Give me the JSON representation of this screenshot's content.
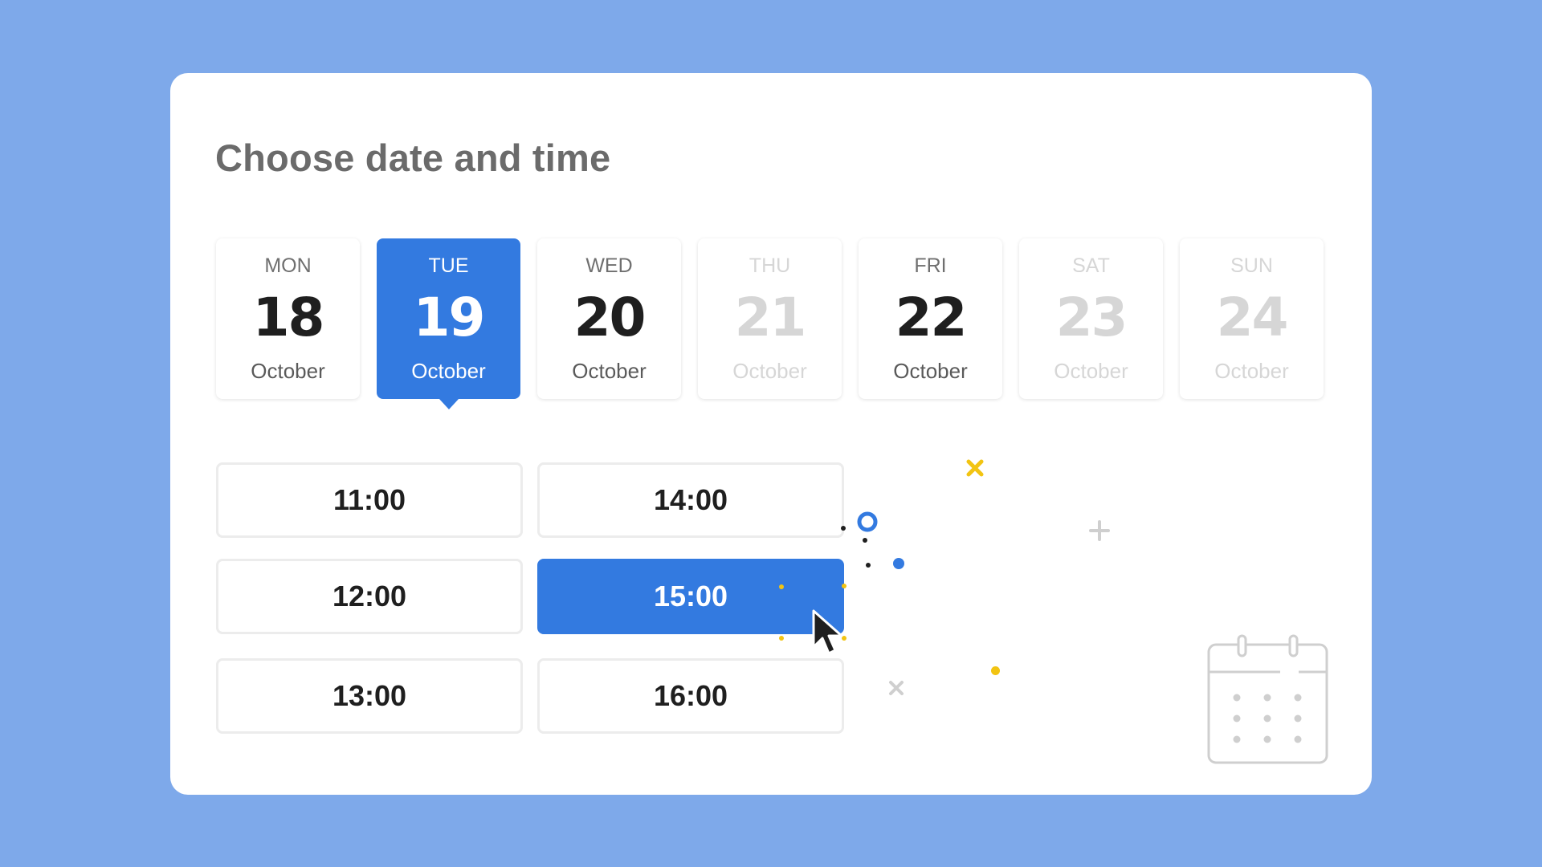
{
  "title": "Choose date and time",
  "colors": {
    "background": "#7ea9ea",
    "accent": "#337ae0",
    "disabled_text": "#d6d6d6",
    "confetti_yellow": "#f2c412"
  },
  "days": [
    {
      "dow": "MON",
      "num": "18",
      "month": "October",
      "state": "available"
    },
    {
      "dow": "TUE",
      "num": "19",
      "month": "October",
      "state": "selected"
    },
    {
      "dow": "WED",
      "num": "20",
      "month": "October",
      "state": "available"
    },
    {
      "dow": "THU",
      "num": "21",
      "month": "October",
      "state": "disabled"
    },
    {
      "dow": "FRI",
      "num": "22",
      "month": "October",
      "state": "available"
    },
    {
      "dow": "SAT",
      "num": "23",
      "month": "October",
      "state": "disabled"
    },
    {
      "dow": "SUN",
      "num": "24",
      "month": "October",
      "state": "disabled"
    }
  ],
  "times": [
    {
      "label": "11:00",
      "selected": false
    },
    {
      "label": "14:00",
      "selected": false
    },
    {
      "label": "12:00",
      "selected": false
    },
    {
      "label": "15:00",
      "selected": true
    },
    {
      "label": "13:00",
      "selected": false
    },
    {
      "label": "16:00",
      "selected": false
    }
  ],
  "icons": {
    "calendar": "calendar-icon",
    "cursor": "mouse-pointer-icon"
  }
}
